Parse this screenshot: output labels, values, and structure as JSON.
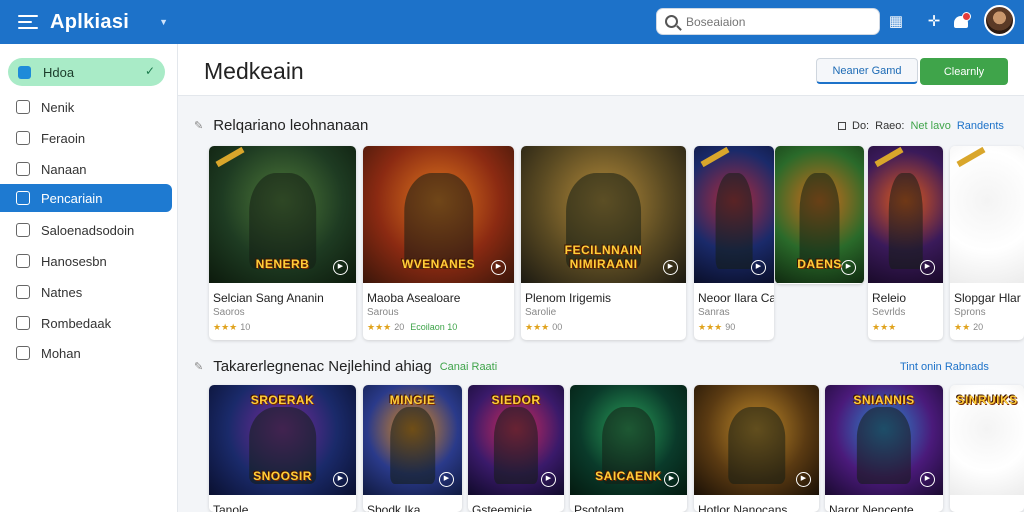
{
  "topbar": {
    "brand": "Aplkiasi",
    "search_placeholder": "Boseaiaion"
  },
  "sidebar": {
    "top": {
      "label": "Hdoa"
    },
    "items": [
      {
        "label": "Nenik",
        "icon": "pin-icon"
      },
      {
        "label": "Feraoin",
        "icon": "file-icon"
      },
      {
        "label": "Nanaan",
        "icon": "home-icon"
      },
      {
        "label": "Pencariain",
        "icon": "list-icon",
        "active": true
      },
      {
        "label": "Saloenadsodoin",
        "icon": "box-icon"
      },
      {
        "label": "Hanosesbn",
        "icon": "circle-icon"
      },
      {
        "label": "Natnes",
        "icon": "link-icon"
      },
      {
        "label": "Rombedaak",
        "icon": "bookmark-icon"
      },
      {
        "label": "Mohan",
        "icon": "note-icon"
      }
    ]
  },
  "header": {
    "title": "Medkeain",
    "btn_outline": "Neaner Gamd",
    "btn_green": "Clearnly"
  },
  "section1": {
    "title": "Relqariano leohnanaan",
    "meta": {
      "a": "Do:",
      "b": "Raeo:",
      "c": "Net lavo",
      "d": "Randents"
    },
    "cards": [
      {
        "name": "Selcian Sang Ananin",
        "sub": "Saoros",
        "stars": "★★★",
        "count": "10",
        "banner": "NENERB",
        "colors": [
          "#1e3b22",
          "#4f7a3a",
          "#0c1a0c"
        ]
      },
      {
        "name": "Maoba Asealoare",
        "sub": "Sarous",
        "stars": "★★★",
        "count": "20",
        "extra": "Ecoilaon 10",
        "banner": "WVENANES",
        "colors": [
          "#8b2a12",
          "#e0781e",
          "#3a160a"
        ]
      },
      {
        "name": "Plenom Irigemis",
        "sub": "Sarolie",
        "stars": "★★★",
        "count": "00",
        "banner": "FECILNNAIN NIMIRAANI",
        "colors": [
          "#5a4a22",
          "#b38a3a",
          "#1c1a12"
        ]
      },
      {
        "name": "Neoor Ilara Cannia",
        "sub": "Sanras",
        "stars": "★★★",
        "count": "90",
        "banner": "",
        "colors": [
          "#1a2a6a",
          "#b02a3a",
          "#0a0f2a"
        ]
      },
      {
        "name": "",
        "sub": "",
        "stars": "",
        "count": "",
        "banner": "DAENS",
        "colors": [
          "#2a6a2a",
          "#d06a1a",
          "#102a10"
        ]
      },
      {
        "name": "Releio",
        "sub": "Sevrlds",
        "stars": "★★★",
        "count": "",
        "banner": "",
        "colors": [
          "#3a1a5a",
          "#e05a1a",
          "#1a0a2a"
        ]
      },
      {
        "name": "Slopgar Hlar",
        "sub": "Sprons",
        "stars": "★★",
        "count": "20",
        "banner": "",
        "colors": [
          "#ffffff",
          "#f4f4f4",
          "#ececec"
        ]
      }
    ]
  },
  "section2": {
    "title": "Takarerlegnenac Nejlehind ahiag",
    "tag": "Canai Raati",
    "link": "Tint onin Rabnads",
    "cards": [
      {
        "name": "Tanole",
        "banner": "SNOOSIR",
        "top": "SROERAK",
        "colors": [
          "#1a2a6a",
          "#7a2a9a",
          "#0a1030"
        ]
      },
      {
        "name": "Sbodk Ika",
        "banner": "",
        "top": "MINGIE",
        "colors": [
          "#2a3a8a",
          "#e08a1a",
          "#101a40"
        ]
      },
      {
        "name": "Gsteemicie",
        "banner": "",
        "top": "SIEDOR",
        "colors": [
          "#3a1a6a",
          "#d02a5a",
          "#100a2a"
        ]
      },
      {
        "name": "Psotolam",
        "banner": "SAICAENK",
        "top": "",
        "colors": [
          "#0a3a2a",
          "#2aa05a",
          "#041a10"
        ]
      },
      {
        "name": "Hotlor Nanocans",
        "banner": "",
        "top": "",
        "colors": [
          "#5a3a12",
          "#c08a2a",
          "#1a1006"
        ]
      },
      {
        "name": "Naror Nencente",
        "banner": "",
        "top": "SNIANNIS",
        "colors": [
          "#4a1a7a",
          "#2a8ad0",
          "#1a0a30"
        ]
      },
      {
        "name": "",
        "banner": "",
        "top": "SINRUIKS",
        "colors": [
          "#ffffff",
          "#f4f4f4",
          "#ececec"
        ]
      }
    ]
  }
}
